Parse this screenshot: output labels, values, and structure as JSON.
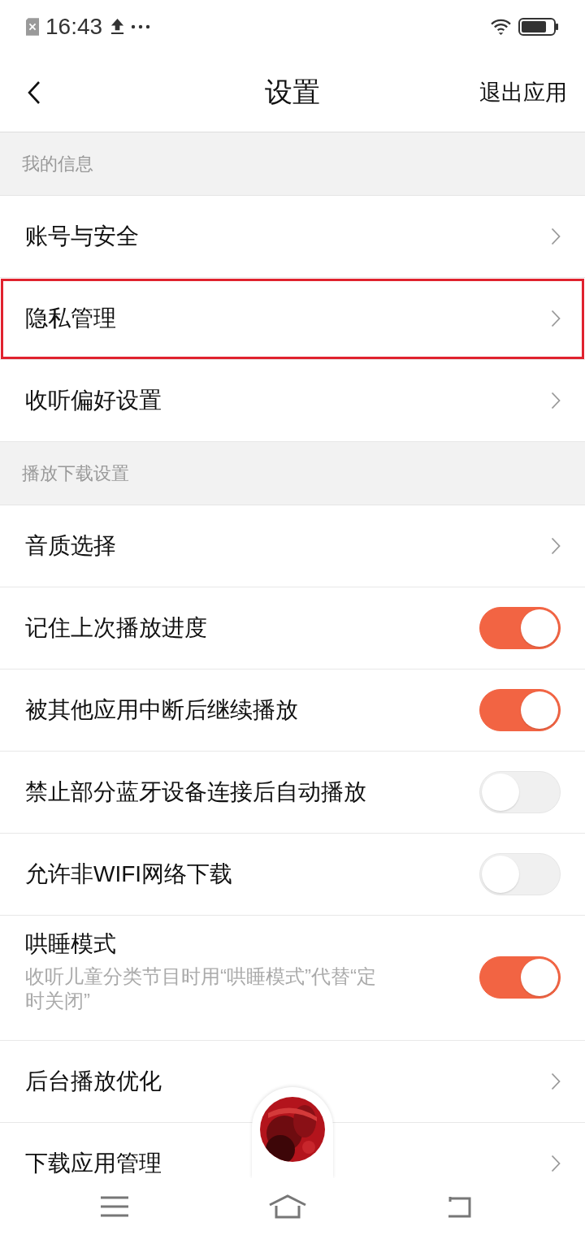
{
  "status_bar": {
    "time": "16:43"
  },
  "header": {
    "title": "设置",
    "action": "退出应用"
  },
  "sections": [
    {
      "title": "我的信息",
      "items": [
        {
          "kind": "link",
          "label": "账号与安全",
          "highlighted": false
        },
        {
          "kind": "link",
          "label": "隐私管理",
          "highlighted": true
        },
        {
          "kind": "link",
          "label": "收听偏好设置",
          "highlighted": false
        }
      ]
    },
    {
      "title": "播放下载设置",
      "items": [
        {
          "kind": "link",
          "label": "音质选择",
          "highlighted": false
        },
        {
          "kind": "toggle",
          "label": "记住上次播放进度",
          "on": true
        },
        {
          "kind": "toggle",
          "label": "被其他应用中断后继续播放",
          "on": true
        },
        {
          "kind": "toggle",
          "label": "禁止部分蓝牙设备连接后自动播放",
          "on": false
        },
        {
          "kind": "toggle",
          "label": "允许非WIFI网络下载",
          "on": false
        },
        {
          "kind": "toggle",
          "label": "哄睡模式",
          "description": "收听儿童分类节目时用“哄睡模式”代替“定时关闭”",
          "on": true
        },
        {
          "kind": "link",
          "label": "后台播放优化",
          "highlighted": false
        },
        {
          "kind": "link",
          "label": "下载应用管理",
          "highlighted": false
        }
      ]
    }
  ]
}
